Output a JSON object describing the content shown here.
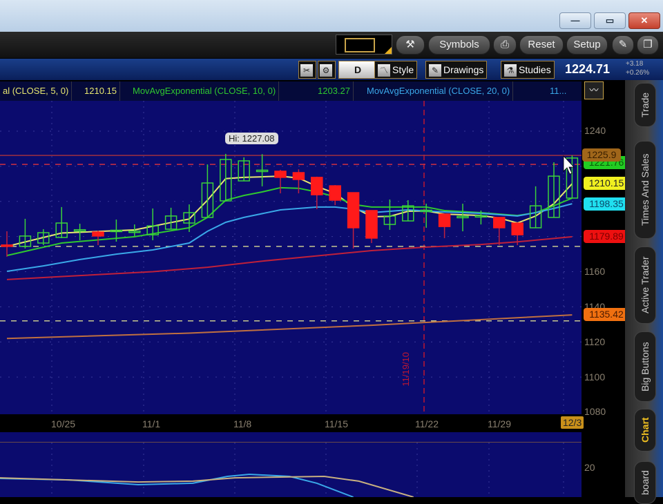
{
  "window": {
    "minimize": "—",
    "maximize": "▭",
    "close": "✕"
  },
  "toolbar": {
    "wrench_icon": "wrench-icon",
    "symbols": "Symbols",
    "print_icon": "printer-icon",
    "reset": "Reset",
    "setup": "Setup",
    "pin_icon": "pin-icon",
    "detach_icon": "detach-icon"
  },
  "header": {
    "aggregation": "D",
    "style": "Style",
    "drawings": "Drawings",
    "studies": "Studies",
    "last_price": "1224.71",
    "change": "+3.18",
    "change_pct": "+0.26%"
  },
  "studies": [
    {
      "label": "al (CLOSE, 5, 0)",
      "value": "1210.15",
      "color": "#e8e870"
    },
    {
      "label": "MovAvgExponential (CLOSE, 10, 0)",
      "value": "1203.27",
      "color": "#2fc82f"
    },
    {
      "label": "MovAvgExponential (CLOSE, 20, 0)",
      "value": "11...",
      "color": "#3aa8e8"
    }
  ],
  "sidebar": {
    "tabs": [
      "Trade",
      "Times And Sales",
      "Active Trader",
      "Big Buttons",
      "Chart",
      "board"
    ],
    "active": "Chart"
  },
  "axis": {
    "ticks": [
      "1240",
      "1160",
      "1140",
      "1120",
      "1100",
      "1080"
    ],
    "lower_tick": "20"
  },
  "price_labels": [
    {
      "value": "1225.9",
      "color": "#a0661a"
    },
    {
      "value": "1221.76",
      "color": "#22cc22"
    },
    {
      "value": "1210.15",
      "color": "#f0f020"
    },
    {
      "value": "1198.35",
      "color": "#20e0f0"
    },
    {
      "value": "1179.89",
      "color": "#ee1010"
    },
    {
      "value": "1135.42",
      "color": "#f07010"
    }
  ],
  "dates": {
    "ticks": [
      "10/25",
      "11/1",
      "11/8",
      "11/15",
      "11/22",
      "11/29"
    ],
    "current": "12/3",
    "marker": "11/19/10"
  },
  "chart_data": [
    {
      "type": "candlestick",
      "ylim": [
        1080,
        1240
      ],
      "hi_label": "Hi: 1227.08",
      "ohlc": [
        [
          1175.2,
          1183.0,
          1168.5,
          1174.4
        ],
        [
          1174.4,
          1190.1,
          1173.2,
          1180.3
        ],
        [
          1176.3,
          1184.2,
          1175.1,
          1182.2
        ],
        [
          1179.5,
          1196.8,
          1179.1,
          1187.7
        ],
        [
          1183.6,
          1187.3,
          1177.9,
          1183.9
        ],
        [
          1182.6,
          1183.4,
          1175.1,
          1180.3
        ],
        [
          1183.2,
          1189.7,
          1177.1,
          1183.6
        ],
        [
          1182.9,
          1186.9,
          1180.3,
          1183.1
        ],
        [
          1181.0,
          1196.0,
          1177.9,
          1186.1
        ],
        [
          1184.2,
          1196.4,
          1184.2,
          1191.7
        ],
        [
          1187.7,
          1198.3,
          1182.6,
          1193.6
        ],
        [
          1190.9,
          1221.1,
          1190.9,
          1210.5
        ],
        [
          1200.3,
          1227.08,
          1199.9,
          1223.9
        ],
        [
          1211.7,
          1225.1,
          1211.7,
          1223.1
        ],
        [
          1217.4,
          1226.9,
          1208.6,
          1217.8
        ],
        [
          1217.2,
          1218.0,
          1204.6,
          1213.7
        ],
        [
          1216.4,
          1218.3,
          1204.6,
          1212.5
        ],
        [
          1213.7,
          1214.1,
          1195.6,
          1203.8
        ],
        [
          1208.9,
          1209.3,
          1197.9,
          1200.7
        ],
        [
          1205.0,
          1205.0,
          1173.2,
          1185.0
        ],
        [
          1194.8,
          1194.8,
          1176.3,
          1179.1
        ],
        [
          1186.9,
          1201.1,
          1183.8,
          1191.7
        ],
        [
          1188.9,
          1200.7,
          1188.9,
          1197.5
        ],
        [
          1194.6,
          1198.7,
          1185.0,
          1195.0
        ],
        [
          1192.8,
          1192.8,
          1179.1,
          1185.7
        ],
        [
          1191.1,
          1198.7,
          1183.0,
          1191.5
        ],
        [
          1191.5,
          1194.8,
          1186.9,
          1191.9
        ],
        [
          1190.9,
          1190.9,
          1175.1,
          1185.0
        ],
        [
          1187.7,
          1187.7,
          1175.1,
          1181.0
        ],
        [
          1185.0,
          1208.6,
          1185.0,
          1197.5
        ],
        [
          1190.9,
          1222.3,
          1190.9,
          1214.4
        ],
        [
          1201.9,
          1226.2,
          1201.9,
          1224.71
        ]
      ],
      "lines": [
        {
          "name": "ema5",
          "color": "#e8e870",
          "points": [
            [
              0,
              1174.4
            ],
            [
              3,
              1182
            ],
            [
              7,
              1183.8
            ],
            [
              9,
              1188
            ],
            [
              10,
              1190
            ],
            [
              11,
              1200.7
            ],
            [
              12,
              1213
            ],
            [
              13,
              1213.7
            ],
            [
              14,
              1214
            ],
            [
              15,
              1214.4
            ],
            [
              16,
              1213.3
            ],
            [
              17,
              1208.6
            ],
            [
              18,
              1204.6
            ],
            [
              19,
              1196.8
            ],
            [
              20,
              1191.3
            ],
            [
              21,
              1191.5
            ],
            [
              22,
              1194.4
            ],
            [
              23,
              1194.6
            ],
            [
              24,
              1192.8
            ],
            [
              25,
              1192.4
            ],
            [
              26,
              1192
            ],
            [
              27,
              1190.5
            ],
            [
              28,
              1187.7
            ],
            [
              29,
              1191.7
            ],
            [
              30,
              1198.7
            ],
            [
              31,
              1210.1
            ]
          ]
        },
        {
          "name": "ema10",
          "color": "#2fc82f",
          "points": [
            [
              0,
              1169.2
            ],
            [
              3,
              1176.3
            ],
            [
              7,
              1179.9
            ],
            [
              10,
              1185
            ],
            [
              11,
              1190.9
            ],
            [
              12,
              1200.7
            ],
            [
              13,
              1203.4
            ],
            [
              14,
              1205.4
            ],
            [
              15,
              1207.8
            ],
            [
              16,
              1207.5
            ],
            [
              17,
              1205.4
            ],
            [
              18,
              1202.7
            ],
            [
              19,
              1198.3
            ],
            [
              20,
              1196.8
            ],
            [
              23,
              1196.8
            ],
            [
              24,
              1194.8
            ],
            [
              26,
              1193.6
            ],
            [
              27,
              1192.8
            ],
            [
              28,
              1192
            ],
            [
              29,
              1193.6
            ],
            [
              30,
              1197.5
            ],
            [
              31,
              1201.9
            ]
          ]
        },
        {
          "name": "ema20",
          "color": "#3aa8e8",
          "points": [
            [
              0,
              1160.2
            ],
            [
              2,
              1163.3
            ],
            [
              4,
              1166.9
            ],
            [
              6,
              1170
            ],
            [
              8,
              1172.4
            ],
            [
              10,
              1176.3
            ],
            [
              11,
              1183
            ],
            [
              12,
              1188.1
            ],
            [
              13,
              1190.9
            ],
            [
              15,
              1195.2
            ],
            [
              17,
              1196.8
            ],
            [
              18,
              1196.8
            ],
            [
              19,
              1195.6
            ],
            [
              20,
              1193.6
            ],
            [
              22,
              1195.2
            ],
            [
              24,
              1194
            ],
            [
              26,
              1193.2
            ],
            [
              28,
              1191.7
            ],
            [
              29,
              1193.6
            ],
            [
              30,
              1196
            ],
            [
              31,
              1198.7
            ]
          ]
        },
        {
          "name": "ma50",
          "color": "#c0203a",
          "points": [
            [
              0,
              1155.5
            ],
            [
              4,
              1157.8
            ],
            [
              8,
              1160
            ],
            [
              11,
              1162.5
            ],
            [
              14,
              1166
            ],
            [
              17,
              1169
            ],
            [
              20,
              1172
            ],
            [
              23,
              1174
            ],
            [
              26,
              1175.5
            ],
            [
              28,
              1177
            ],
            [
              31,
              1179.9
            ]
          ]
        },
        {
          "name": "ma200",
          "color": "#c07040",
          "points": [
            [
              0,
              1122
            ],
            [
              10,
              1125
            ],
            [
              20,
              1129.5
            ],
            [
              31,
              1135.4
            ]
          ]
        }
      ],
      "hlines": [
        {
          "value": 1226.2,
          "color": "#a03040",
          "style": "solid"
        },
        {
          "value": 1221.1,
          "color": "#d03040",
          "style": "dashed"
        },
        {
          "value": 1174.4,
          "color": "#c8c890",
          "style": "dashed"
        },
        {
          "value": 1132,
          "color": "#c8c890",
          "style": "dashed"
        }
      ],
      "marker_index": 22.5
    },
    {
      "type": "line",
      "name": "lower-oscillator",
      "series": [
        {
          "name": "fast",
          "color": "#3aa8e8",
          "points": [
            [
              -0.4,
              15
            ],
            [
              3.4,
              14.3
            ],
            [
              7.2,
              12
            ],
            [
              10.2,
              12.7
            ],
            [
              12.1,
              16
            ],
            [
              13.3,
              17
            ],
            [
              15.5,
              16
            ],
            [
              17,
              12.7
            ],
            [
              19,
              6
            ]
          ]
        },
        {
          "name": "slow",
          "color": "#c8b080",
          "points": [
            [
              -0.4,
              15.3
            ],
            [
              7.2,
              13.3
            ],
            [
              10.2,
              13.7
            ],
            [
              12.5,
              15.3
            ],
            [
              17.4,
              16
            ],
            [
              19.3,
              13.7
            ],
            [
              22.3,
              6
            ]
          ]
        }
      ]
    }
  ]
}
